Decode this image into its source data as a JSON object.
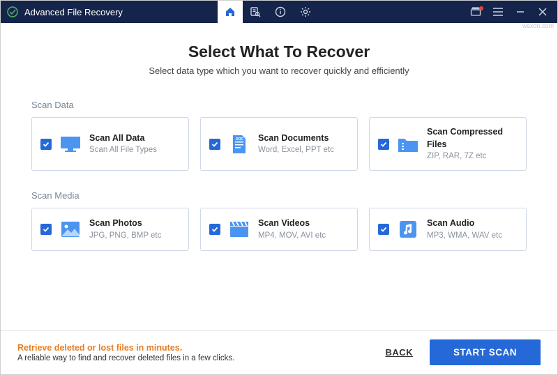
{
  "app": {
    "title": "Advanced File Recovery"
  },
  "page": {
    "title": "Select What To Recover",
    "subtitle": "Select data type which you want to recover quickly and efficiently"
  },
  "sections": {
    "data": {
      "label": "Scan Data",
      "cards": [
        {
          "title": "Scan All Data",
          "desc": "Scan All File Types"
        },
        {
          "title": "Scan Documents",
          "desc": "Word, Excel, PPT etc"
        },
        {
          "title": "Scan Compressed Files",
          "desc": "ZIP, RAR, 7Z etc"
        }
      ]
    },
    "media": {
      "label": "Scan Media",
      "cards": [
        {
          "title": "Scan Photos",
          "desc": "JPG, PNG, BMP etc"
        },
        {
          "title": "Scan Videos",
          "desc": "MP4, MOV, AVI etc"
        },
        {
          "title": "Scan Audio",
          "desc": "MP3, WMA, WAV etc"
        }
      ]
    }
  },
  "footer": {
    "promo_title": "Retrieve deleted or lost files in minutes.",
    "promo_sub": "A reliable way to find and recover deleted files in a few clicks.",
    "back": "BACK",
    "scan": "START SCAN"
  },
  "watermark": "wsxdn.com"
}
